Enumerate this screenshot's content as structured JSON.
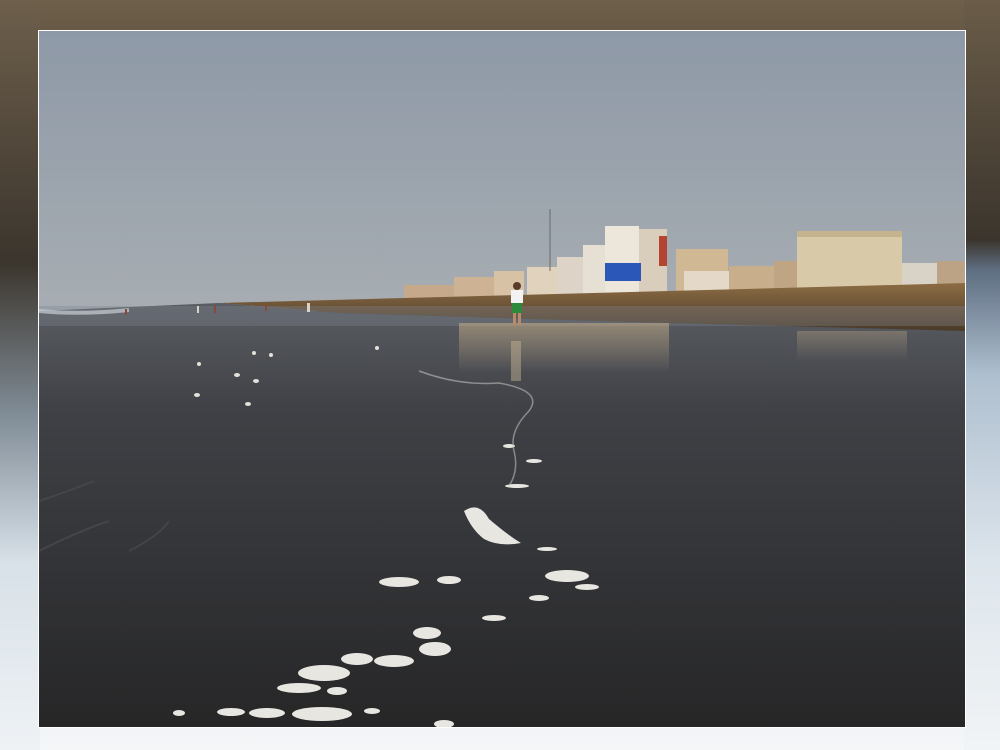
{
  "scene": {
    "subject": "beach-at-low-tide",
    "colors": {
      "sky_top": "#8d98a6",
      "sky_horizon": "#a6acb1",
      "sand": "#7a5f3d",
      "wet_sand": "#2e2e2f",
      "foam": "#e8e6e1",
      "frame_top": "#6e5f4a",
      "frame_bottom": "#f4f6f8"
    }
  }
}
